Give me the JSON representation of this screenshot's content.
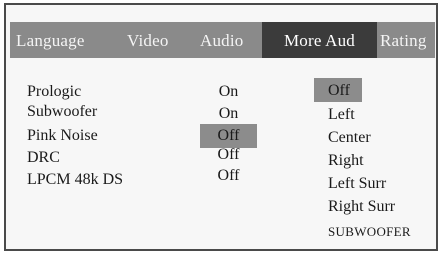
{
  "tabs": {
    "language": "Language",
    "video": "Video",
    "audio": "Audio",
    "more_audio": "More Aud",
    "rating": "Rating"
  },
  "settings": [
    {
      "label": "Prologic",
      "value": "On"
    },
    {
      "label": "Subwoofer",
      "value": "On"
    },
    {
      "label": "Pink Noise",
      "value": "Off"
    },
    {
      "label": "DRC",
      "value": "Off"
    },
    {
      "label": "LPCM 48k DS",
      "value": "Off"
    }
  ],
  "options": [
    "Off",
    "Left",
    "Center",
    "Right",
    "Left Surr",
    "Right Surr",
    "SUBWOOFER"
  ],
  "colors": {
    "tab_bar": "#8a8a8a",
    "active_tab": "#3b3b3b",
    "highlight": "#8c8c8c",
    "background": "#f7f7f7",
    "border": "#4a4a4a"
  }
}
